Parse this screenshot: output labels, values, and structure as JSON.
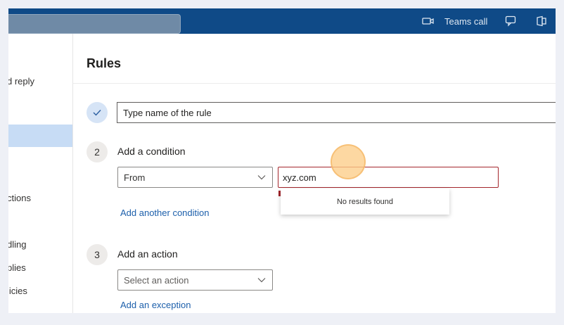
{
  "topbar": {
    "teams_call_label": "Teams call",
    "icons": [
      "video-icon",
      "chat-icon",
      "office-icon"
    ]
  },
  "leftnav": {
    "items": [
      {
        "label": "d reply"
      },
      {
        "label": "ctions"
      },
      {
        "label": "dling"
      },
      {
        "label": "plies"
      },
      {
        "label": "licies"
      }
    ]
  },
  "rules": {
    "title": "Rules",
    "step1": {
      "placeholder": "Type name of the rule"
    },
    "step2": {
      "number": "2",
      "heading": "Add a condition",
      "condition_selected": "From",
      "value": "xyz.com",
      "suggestions_message": "No results found",
      "add_condition_link": "Add another condition"
    },
    "step3": {
      "number": "3",
      "heading": "Add an action",
      "action_placeholder": "Select an action",
      "add_exception_link": "Add an exception"
    }
  },
  "colors": {
    "topbar": "#0f4a87",
    "link": "#1c5fab",
    "error": "#a4262c",
    "selected_nav": "#c7dcf5"
  }
}
